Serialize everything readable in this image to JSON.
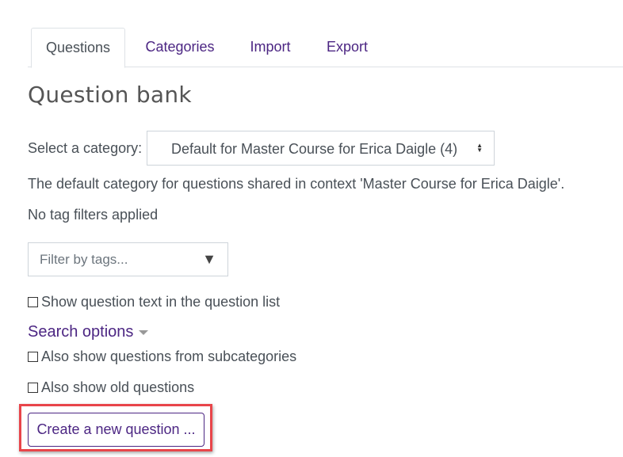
{
  "tabs": [
    {
      "label": "Questions",
      "active": true
    },
    {
      "label": "Categories",
      "active": false
    },
    {
      "label": "Import",
      "active": false
    },
    {
      "label": "Export",
      "active": false
    }
  ],
  "page": {
    "title": "Question bank",
    "select_category_label": "Select a category:",
    "selected_category": "Default for Master Course for Erica Daigle (4)",
    "category_description": "The default category for questions shared in context 'Master Course for Erica Daigle'.",
    "tag_status": "No tag filters applied",
    "tag_filter_placeholder": "Filter by tags...",
    "show_question_text_label": "Show question text in the question list",
    "search_options_label": "Search options",
    "subcategories_label": "Also show questions from subcategories",
    "old_questions_label": "Also show old questions",
    "create_button_label": "Create a new question ..."
  },
  "colors": {
    "link": "#4c2683",
    "highlight": "#e8454a"
  }
}
